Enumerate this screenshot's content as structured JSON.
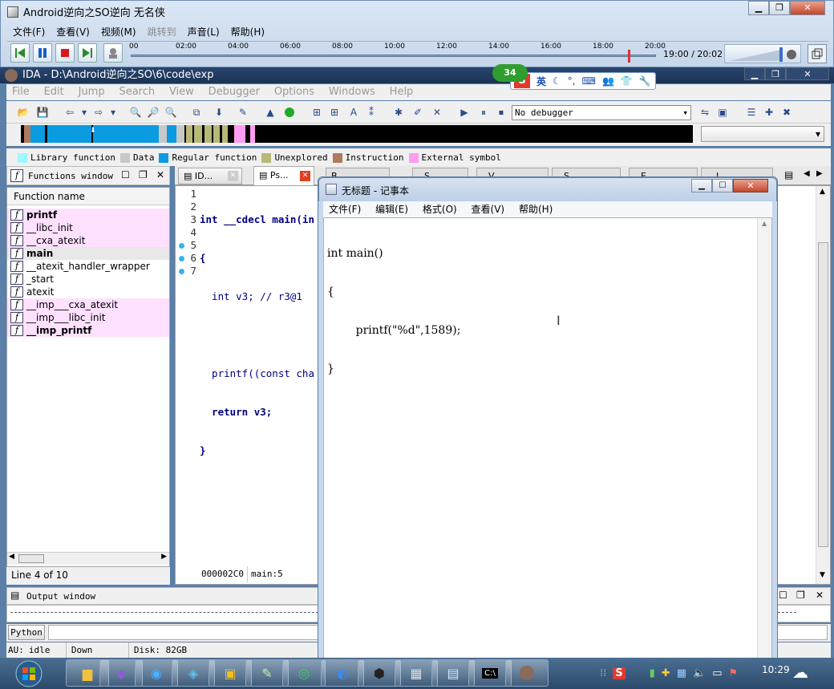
{
  "player": {
    "title": "Android逆向之SO逆向 无名侠",
    "menu": [
      "文件(F)",
      "查看(V)",
      "视频(M)",
      "跳转到",
      "声音(L)",
      "帮助(H)"
    ],
    "timeline_ticks": [
      "00",
      "02:00",
      "04:00",
      "06:00",
      "08:00",
      "10:00",
      "12:00",
      "14:00",
      "16:00",
      "18:00",
      "20:00"
    ],
    "time_display": "19:00 / 20:02",
    "progress": 0.95
  },
  "ime": {
    "badge": "34",
    "lang": "英"
  },
  "ida": {
    "title": "IDA - D:\\Android逆向之SO\\6\\code\\exp",
    "menu": [
      "File",
      "Edit",
      "Jump",
      "Search",
      "View",
      "Debugger",
      "Options",
      "Windows",
      "Help"
    ],
    "debugger_select": "No debugger",
    "legend": [
      {
        "label": "Library function",
        "color": "#9ff7ff"
      },
      {
        "label": "Data",
        "color": "#c8c8c8"
      },
      {
        "label": "Regular function",
        "color": "#0a9be0"
      },
      {
        "label": "Unexplored",
        "color": "#b8b878"
      },
      {
        "label": "Instruction",
        "color": "#b07a5c"
      },
      {
        "label": "External symbol",
        "color": "#ff9cf4"
      }
    ],
    "functions_window": {
      "title": "Functions window",
      "column": "Function name",
      "items": [
        {
          "name": "printf",
          "bold": true,
          "color": "#ffe1ff"
        },
        {
          "name": "__libc_init",
          "bold": false,
          "color": "#ffe1ff"
        },
        {
          "name": "__cxa_atexit",
          "bold": false,
          "color": "#ffe1ff"
        },
        {
          "name": "main",
          "bold": true,
          "color": "#e8e8e8"
        },
        {
          "name": "__atexit_handler_wrapper",
          "bold": false,
          "color": "#ffffff"
        },
        {
          "name": "_start",
          "bold": false,
          "color": "#ffffff"
        },
        {
          "name": "atexit",
          "bold": false,
          "color": "#ffffff"
        },
        {
          "name": "__imp___cxa_atexit",
          "bold": false,
          "color": "#ffe1ff"
        },
        {
          "name": "__imp___libc_init",
          "bold": false,
          "color": "#ffe1ff"
        },
        {
          "name": "__imp_printf",
          "bold": true,
          "color": "#ffe1ff"
        }
      ],
      "status": "Line 4 of 10"
    },
    "tabs": [
      "ID...",
      "Ps...",
      "B...",
      "S...",
      "V...",
      "S...",
      "E...",
      "I..."
    ],
    "pseudocode": {
      "lines": [
        {
          "num": "1",
          "dot": false,
          "text": "int __cdecl main(in"
        },
        {
          "num": "2",
          "dot": false,
          "text": "{"
        },
        {
          "num": "3",
          "dot": false,
          "text": "  int v3; // r3@1"
        },
        {
          "num": "4",
          "dot": false,
          "text": ""
        },
        {
          "num": "5",
          "dot": true,
          "text": "  printf((const cha"
        },
        {
          "num": "6",
          "dot": true,
          "text": "  return v3;"
        },
        {
          "num": "7",
          "dot": true,
          "text": "}"
        }
      ],
      "status_addr": "000002C0",
      "status_loc": "main:5"
    },
    "output_window": {
      "title": "Output window"
    },
    "python_label": "Python",
    "statusbar": {
      "au": "AU:",
      "state": "idle",
      "dir": "Down",
      "disk": "Disk: 82GB"
    }
  },
  "notepad": {
    "title": "无标题 - 记事本",
    "menu": [
      "文件(F)",
      "编辑(E)",
      "格式(O)",
      "查看(V)",
      "帮助(H)"
    ],
    "lines": [
      "int main()",
      "{",
      "        printf(\"%d\",1589);",
      "}"
    ]
  },
  "taskbar": {
    "clock": "10:29"
  }
}
